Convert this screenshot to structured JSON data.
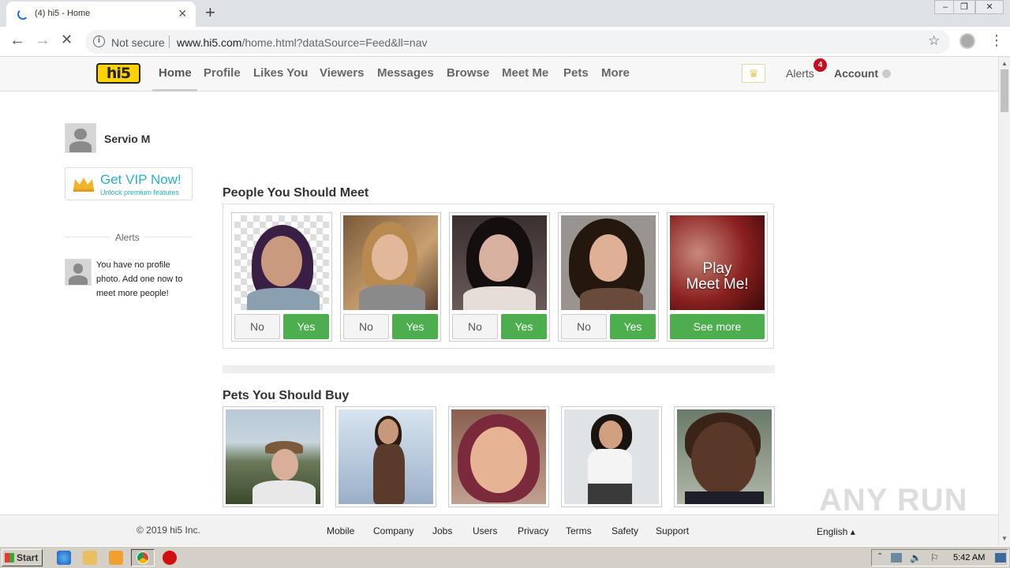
{
  "browser": {
    "tab_title": "(4) hi5 - Home",
    "new_tab": "+",
    "not_secure": "Not secure",
    "url_host": "www.hi5.com",
    "url_path": "/home.html?dataSource=Feed&ll=nav"
  },
  "site": {
    "logo": "hi5",
    "nav": [
      "Home",
      "Profile",
      "Likes You",
      "Viewers",
      "Messages",
      "Browse",
      "Meet Me",
      "Pets",
      "More"
    ],
    "alerts_label": "Alerts",
    "alerts_count": "4",
    "account_label": "Account"
  },
  "sidebar": {
    "user_name": "Servio M",
    "vip_title": "Get VIP Now!",
    "vip_subtitle": "Unlock premium features",
    "alerts_heading": "Alerts",
    "alert_message": "You have no profile photo. Add one now to meet more people!"
  },
  "meet": {
    "title": "People You Should Meet",
    "no_label": "No",
    "yes_label": "Yes",
    "play_line1": "Play",
    "play_line2": "Meet Me!",
    "see_more": "See more"
  },
  "pets": {
    "title": "Pets You Should Buy"
  },
  "footer": {
    "copyright": "© 2019 hi5 Inc.",
    "links": [
      "Mobile",
      "Company",
      "Jobs",
      "Users",
      "Privacy",
      "Terms",
      "Safety",
      "Support"
    ],
    "language": "English ▴"
  },
  "watermark": "ANY RUN",
  "taskbar": {
    "start": "Start",
    "clock": "5:42 AM"
  },
  "colors": {
    "yes_green": "#4cae4c",
    "vip_teal": "#29b3c4",
    "alert_red": "#c40f1c",
    "logo_yellow": "#ffd200"
  }
}
